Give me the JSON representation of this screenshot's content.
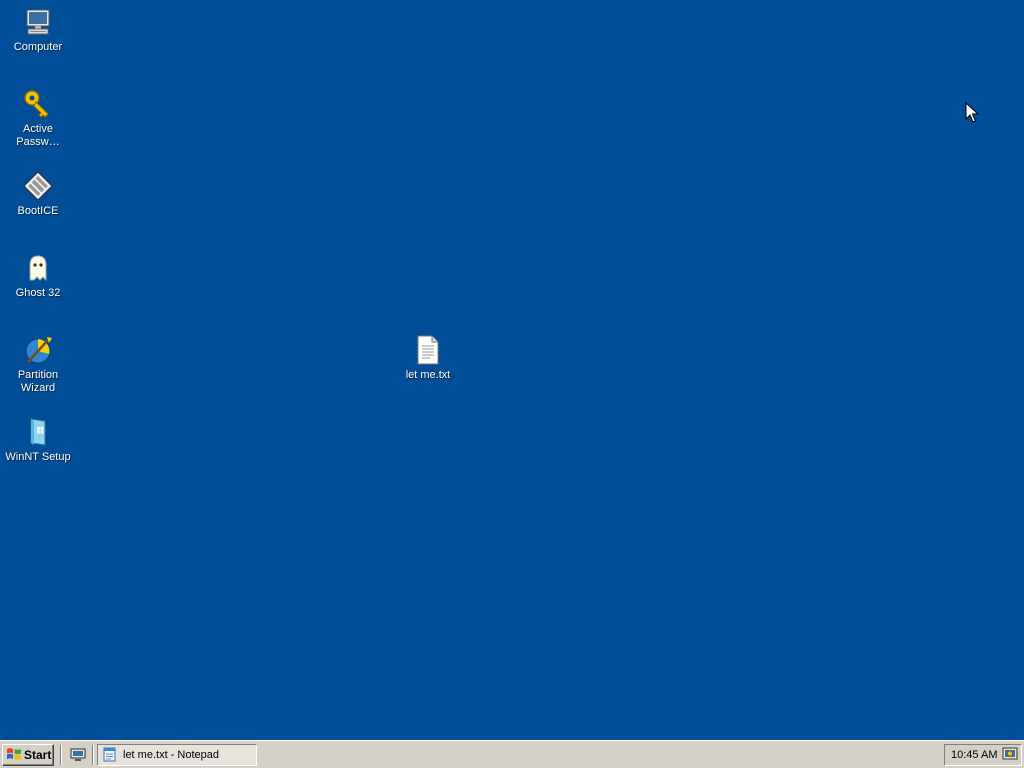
{
  "desktop": {
    "background_color": "#004e98",
    "icons": [
      {
        "label": "Computer",
        "icon": "computer-icon"
      },
      {
        "label": "Active\nPassw…",
        "icon": "key-icon"
      },
      {
        "label": "BootICE",
        "icon": "bootice-icon"
      },
      {
        "label": "Ghost 32",
        "icon": "ghost-icon"
      },
      {
        "label": "Partition\nWizard",
        "icon": "partition-wizard-icon"
      },
      {
        "label": "WinNT Setup",
        "icon": "winnt-setup-icon"
      },
      {
        "label": "let me.txt",
        "icon": "text-file-icon"
      }
    ]
  },
  "taskbar": {
    "start_label": "Start",
    "quick_launch_icon": "show-desktop-icon",
    "tasks": [
      {
        "label": "let me.txt - Notepad",
        "icon": "notepad-icon"
      }
    ],
    "tray": {
      "clock": "10:45 AM",
      "icon": "tray-network-icon"
    }
  }
}
